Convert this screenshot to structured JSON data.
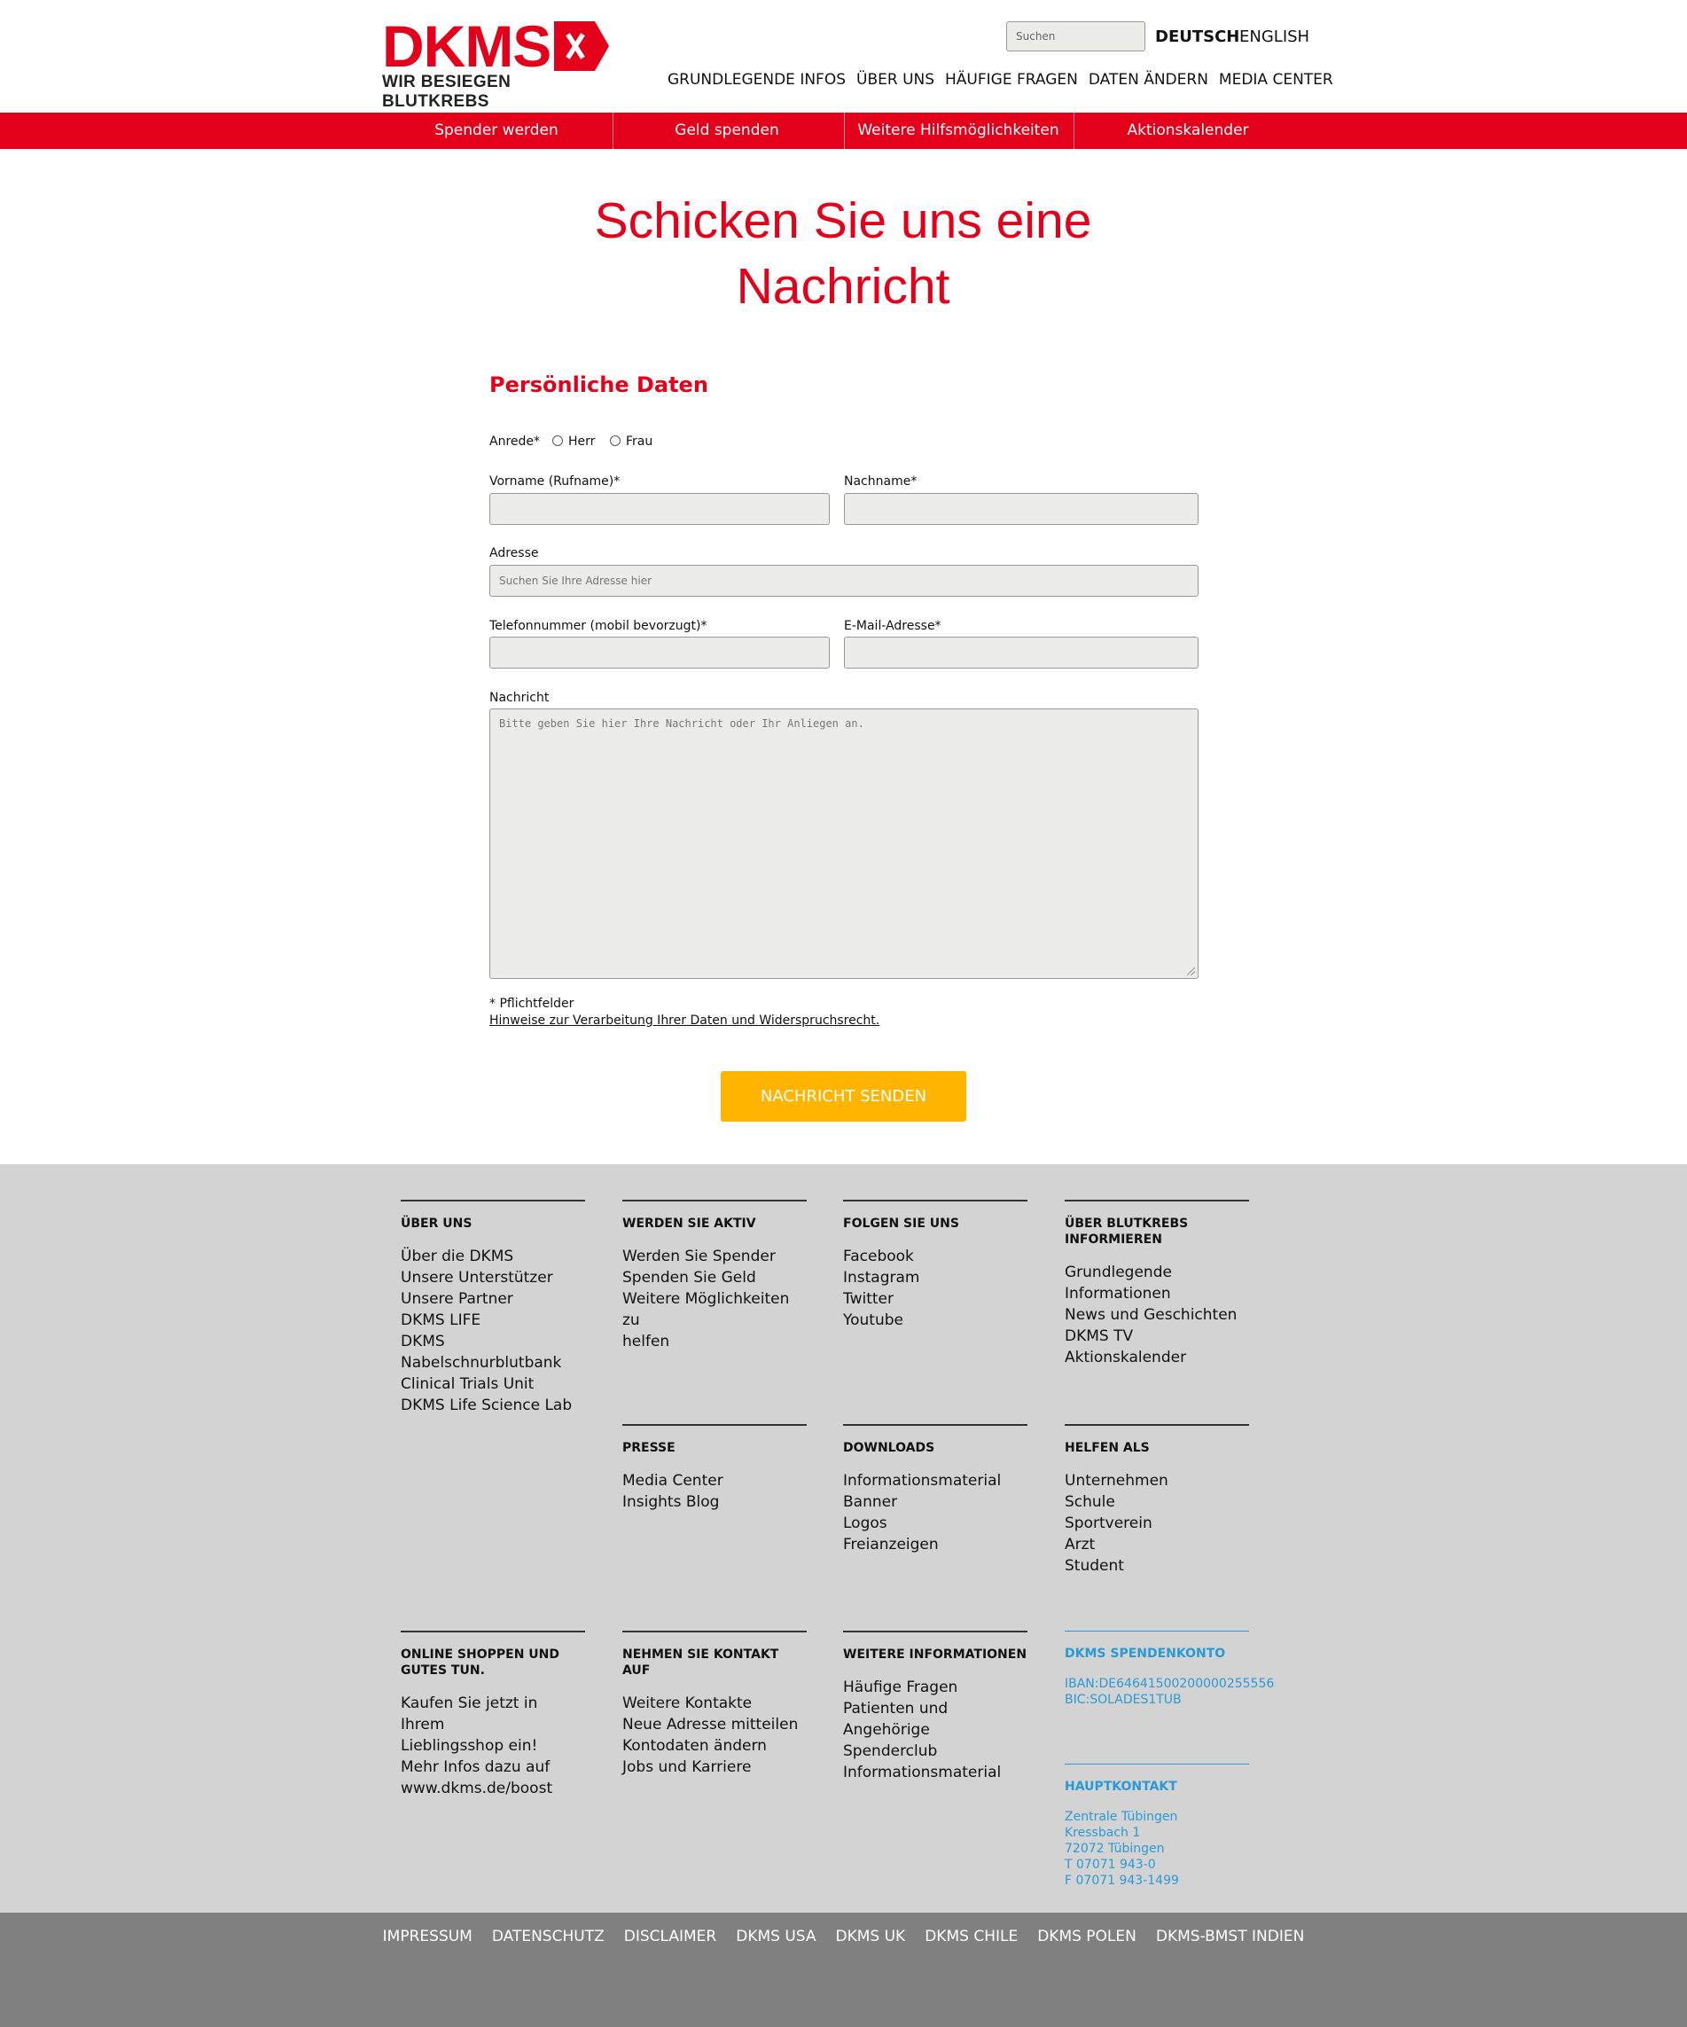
{
  "header": {
    "logo_text": "DKMS",
    "logo_tagline": "WIR BESIEGEN BLUTKREBS",
    "search_placeholder": "Suchen",
    "lang_de": "DEUTSCH",
    "lang_en": "ENGLISH",
    "top_nav": [
      "GRUNDLEGENDE INFOS",
      "ÜBER UNS",
      "HÄUFIGE FRAGEN",
      "DATEN ÄNDERN",
      "MEDIA CENTER"
    ],
    "main_nav": [
      "Spender werden",
      "Geld spenden",
      "Weitere Hilfsmöglichkeiten",
      "Aktionskalender"
    ],
    "brand_red": "#e3001b"
  },
  "main": {
    "title_line1": "Schicken Sie uns eine",
    "title_line2": "Nachricht",
    "section_title": "Persönliche Daten",
    "salutation_label": "Anrede*",
    "salutation_options": [
      "Herr",
      "Frau"
    ],
    "firstname_label": "Vorname (Rufname)*",
    "lastname_label": "Nachname*",
    "address_label": "Adresse",
    "address_placeholder": "Suchen Sie Ihre Adresse hier",
    "phone_label": "Telefonnummer (mobil bevorzugt)*",
    "email_label": "E-Mail-Adresse*",
    "message_label": "Nachricht",
    "message_placeholder": "Bitte geben Sie hier Ihre Nachricht oder Ihr Anliegen an.",
    "required_note": "* Pflichtfelder",
    "privacy_link": "Hinweise zur Verarbeitung Ihrer Daten und Widerspruchsrecht.",
    "submit_label": "NACHRICHT SENDEN",
    "submit_color": "#ffb400"
  },
  "footer": {
    "columns": [
      {
        "heading": "ÜBER UNS",
        "links": [
          "Über die DKMS",
          "Unsere Unterstützer",
          "Unsere Partner",
          "DKMS LIFE",
          "DKMS",
          "Nabelschnurblutbank",
          "Clinical Trials Unit",
          "DKMS Life Science Lab"
        ]
      },
      {
        "heading": "WERDEN SIE AKTIV",
        "links": [
          "Werden Sie Spender",
          "Spenden Sie Geld",
          "Weitere Möglichkeiten zu",
          "helfen"
        ]
      },
      {
        "heading": "FOLGEN SIE UNS",
        "links": [
          "Facebook",
          "Instagram",
          "Twitter",
          "Youtube"
        ]
      },
      {
        "heading": "ÜBER BLUTKREBS INFORMIEREN",
        "links": [
          "Grundlegende",
          "Informationen",
          "News und Geschichten",
          "DKMS TV",
          "Aktionskalender"
        ]
      },
      {
        "heading": "PRESSE",
        "links": [
          "Media Center",
          "Insights Blog"
        ]
      },
      {
        "heading": "DOWNLOADS",
        "links": [
          "Informationsmaterial",
          "Banner",
          "Logos",
          "Freianzeigen"
        ]
      },
      {
        "heading": "HELFEN ALS",
        "links": [
          "Unternehmen",
          "Schule",
          "Sportverein",
          "Arzt",
          "Student"
        ]
      },
      {
        "heading": "ONLINE SHOPPEN UND GUTES TUN.",
        "links": [
          "Kaufen Sie jetzt in Ihrem",
          "Lieblingsshop ein!",
          "Mehr Infos dazu auf",
          "www.dkms.de/boost"
        ]
      },
      {
        "heading": "NEHMEN SIE KONTAKT AUF",
        "links": [
          "Weitere Kontakte",
          "Neue Adresse mitteilen",
          "Kontodaten ändern",
          "Jobs und Karriere"
        ]
      },
      {
        "heading": "WEITERE INFORMATIONEN",
        "links": [
          "Häufige Fragen",
          "Patienten und Angehörige",
          "Spenderclub",
          "Informationsmaterial"
        ]
      }
    ],
    "account": {
      "heading": "DKMS SPENDENKONTO",
      "lines": [
        "IBAN:DE64641500200000255556",
        "BIC:SOLADES1TUB"
      ]
    },
    "contact": {
      "heading": "HAUPTKONTAKT",
      "lines": [
        "Zentrale Tübingen",
        "Kressbach 1",
        "72072 Tübingen",
        "T 07071 943-0",
        "F 07071 943-1499"
      ]
    },
    "info_color": "#2a9ad6",
    "bottom_links": [
      "IMPRESSUM",
      "DATENSCHUTZ",
      "DISCLAIMER",
      "DKMS USA",
      "DKMS UK",
      "DKMS CHILE",
      "DKMS POLEN",
      "DKMS-BMST INDIEN"
    ]
  }
}
